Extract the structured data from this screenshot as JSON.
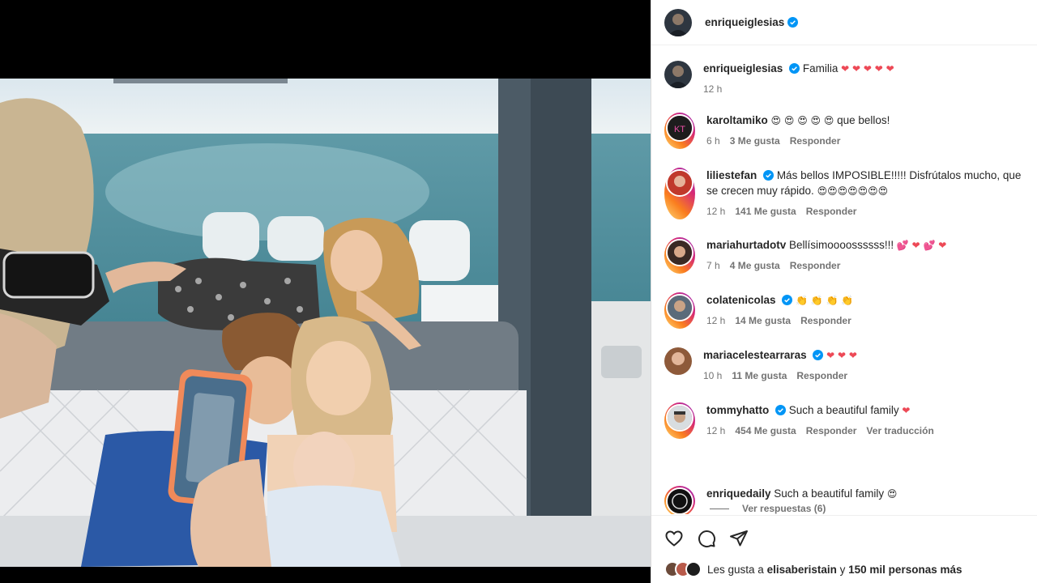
{
  "post": {
    "author": "enriqueiglesias",
    "caption": "Familia",
    "caption_emoji": "❤ ❤ ❤ ❤ ❤",
    "time": "12 h"
  },
  "comments": [
    {
      "user": "karoltamiko",
      "verified": false,
      "text": "que bellos!",
      "emoji": "😍 😍 😍 😍 😍",
      "time": "6 h",
      "likes": "3 Me gusta",
      "reply": "Responder"
    },
    {
      "user": "liliestefan",
      "verified": true,
      "text": "Más bellos IMPOSIBLE!!!!! Disfrútalos mucho, que se crecen muy rápido.",
      "emoji": "😍😍😍😍😍😍😍",
      "time": "12 h",
      "likes": "141 Me gusta",
      "reply": "Responder"
    },
    {
      "user": "mariahurtadotv",
      "verified": false,
      "text": "Bellísimoooossssss!!!",
      "emoji": "💕 ❤ 💕 ❤",
      "time": "7 h",
      "likes": "4 Me gusta",
      "reply": "Responder"
    },
    {
      "user": "colatenicolas",
      "verified": true,
      "text": "",
      "emoji": "👏 👏 👏 👏",
      "time": "12 h",
      "likes": "14 Me gusta",
      "reply": "Responder"
    },
    {
      "user": "mariacelestearraras",
      "verified": true,
      "text": "",
      "emoji": "❤ ❤ ❤",
      "time": "10 h",
      "likes": "11 Me gusta",
      "reply": "Responder"
    },
    {
      "user": "tommyhatto",
      "verified": true,
      "text": "Such a beautiful family",
      "emoji": "❤",
      "time": "12 h",
      "likes": "454 Me gusta",
      "reply": "Responder",
      "translate": "Ver traducción"
    },
    {
      "user": "enriquedaily",
      "verified": false,
      "text": "Such a beautiful family",
      "emoji": "😍",
      "time": "",
      "likes": "",
      "reply": ""
    }
  ],
  "view_replies": "Ver respuestas (6)",
  "likes_line": {
    "prefix": "Les gusta a",
    "user": "elisaberistain",
    "middle": "y",
    "count": "150 mil personas más"
  },
  "colors": {
    "verified": "#0095f6",
    "heart": "#ed4956",
    "text": "#262626",
    "muted": "#737373"
  },
  "icons": [
    "heart-icon",
    "comment-icon",
    "share-icon"
  ]
}
